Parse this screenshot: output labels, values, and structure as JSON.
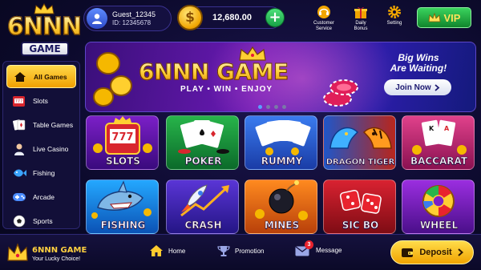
{
  "logo": {
    "main": "6NNN",
    "sub": "GAME"
  },
  "user": {
    "name": "Guest_12345",
    "id": "ID: 12345678"
  },
  "balance": {
    "amount": "12,680.00",
    "coin_symbol": "$"
  },
  "top_actions": [
    {
      "label": "Customer\nService",
      "icon": "headset-icon"
    },
    {
      "label": "Daily\nBonus",
      "icon": "gift-icon"
    },
    {
      "label": "Setting",
      "icon": "gear-icon"
    }
  ],
  "vip": {
    "label": "VIP",
    "icon": "crown-icon"
  },
  "sidebar": {
    "items": [
      {
        "label": "All Games",
        "icon": "home-icon",
        "active": true
      },
      {
        "label": "Slots",
        "icon": "slot-machine-icon"
      },
      {
        "label": "Table Games",
        "icon": "cards-icon"
      },
      {
        "label": "Live Casino",
        "icon": "dealer-icon"
      },
      {
        "label": "Fishing",
        "icon": "fish-icon"
      },
      {
        "label": "Arcade",
        "icon": "gamepad-icon"
      },
      {
        "label": "Sports",
        "icon": "soccer-ball-icon"
      }
    ]
  },
  "banner": {
    "title": "6NNN GAME",
    "tagline": "PLAY • WIN • ENJOY",
    "big_wins_line1": "Big Wins",
    "big_wins_line2": "Are Waiting!",
    "join_label": "Join Now",
    "page_count": 4,
    "active_page": 1
  },
  "games": [
    {
      "label": "SLOTS"
    },
    {
      "label": "POKER"
    },
    {
      "label": "RUMMY"
    },
    {
      "label": "DRAGON TIGER"
    },
    {
      "label": "BACCARAT"
    },
    {
      "label": "FISHING"
    },
    {
      "label": "CRASH"
    },
    {
      "label": "MINES"
    },
    {
      "label": "SIC BO"
    },
    {
      "label": "WHEEL"
    }
  ],
  "footer": {
    "brand": "6NNN GAME",
    "slogan": "Your Lucky Choice!",
    "nav": [
      {
        "label": "Home",
        "icon": "home-icon",
        "active": true
      },
      {
        "label": "Promotion",
        "icon": "trophy-icon"
      },
      {
        "label": "Message",
        "icon": "mail-icon",
        "badge": "3"
      }
    ],
    "deposit_label": "Deposit"
  },
  "colors": {
    "accent_gold": "#ffcb2e",
    "background": "#0c0a2c",
    "add_green": "#17a046"
  }
}
